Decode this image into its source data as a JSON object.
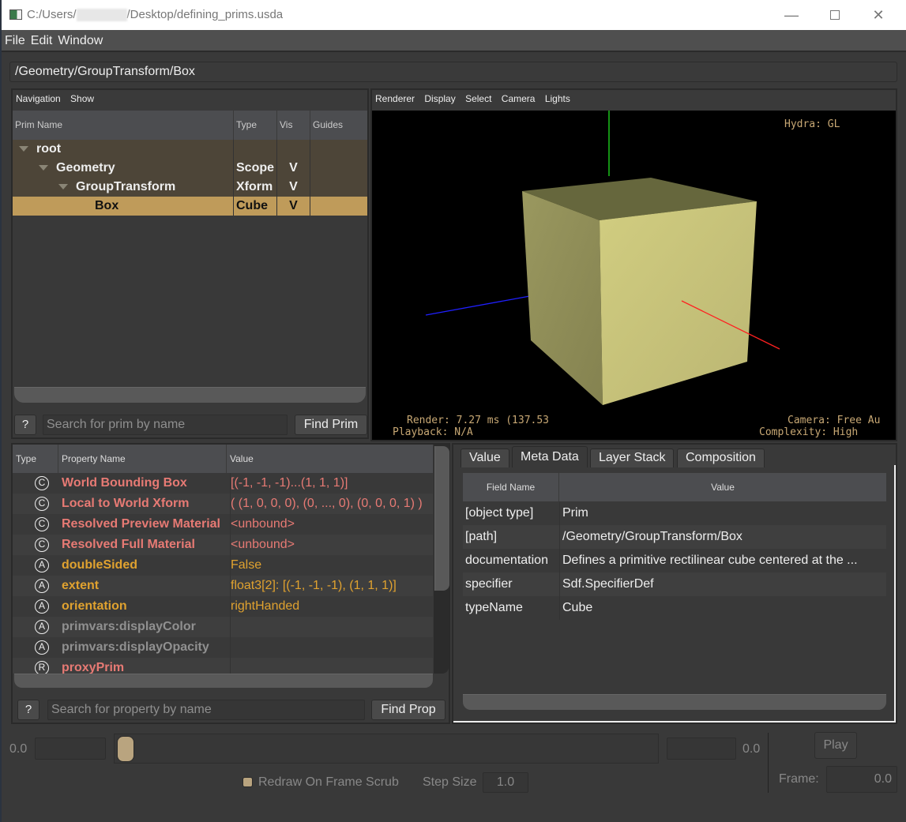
{
  "window": {
    "title_prefix": "C:/Users/",
    "title_suffix": "/Desktop/defining_prims.usda",
    "minimize": "—",
    "maximize": "☐",
    "close": "✕"
  },
  "menubar": {
    "items": [
      "File",
      "Edit",
      "Window"
    ]
  },
  "path_field": {
    "value": "/Geometry/GroupTransform/Box"
  },
  "prim_browser": {
    "menus": [
      "Navigation",
      "Show"
    ],
    "columns": [
      "Prim Name",
      "Type",
      "Vis",
      "Guides"
    ],
    "rows": [
      {
        "name": "root",
        "type": "",
        "vis": "",
        "guides": "",
        "depth": 0,
        "expanded": true,
        "selected": false
      },
      {
        "name": "Geometry",
        "type": "Scope",
        "vis": "V",
        "guides": "",
        "depth": 1,
        "expanded": true,
        "selected": false
      },
      {
        "name": "GroupTransform",
        "type": "Xform",
        "vis": "V",
        "guides": "",
        "depth": 2,
        "expanded": true,
        "selected": false
      },
      {
        "name": "Box",
        "type": "Cube",
        "vis": "V",
        "guides": "",
        "depth": 3,
        "expanded": false,
        "selected": true
      }
    ],
    "help_label": "?",
    "search_placeholder": "Search for prim by name",
    "find_label": "Find Prim"
  },
  "viewport": {
    "menus": [
      "Renderer",
      "Display",
      "Select",
      "Camera",
      "Lights"
    ],
    "renderer_label": "Hydra: GL",
    "hud_render": "Render: 7.27 ms (137.53",
    "hud_playback": "Playback: N/A",
    "hud_camera": "Camera: Free Au",
    "hud_complexity": "Complexity: High",
    "colors": {
      "cube_top": "#66673d",
      "cube_left": "#8f8d57",
      "cube_front": "#c9c57a",
      "axis_x": "#ff2020",
      "axis_y": "#20e020",
      "axis_z": "#2020ff"
    }
  },
  "property_view": {
    "columns": [
      "Type",
      "Property Name",
      "Value"
    ],
    "rows": [
      {
        "type_icon": "C",
        "icon_name": "computed-icon",
        "name": "World Bounding Box",
        "value": "[(-1, -1, -1)...(1, 1, 1)]",
        "color": "red"
      },
      {
        "type_icon": "C",
        "icon_name": "computed-icon",
        "name": "Local to World Xform",
        "value": "( (1, 0, 0, 0), (0, ..., 0), (0, 0, 0, 1) )",
        "color": "red"
      },
      {
        "type_icon": "C",
        "icon_name": "computed-icon",
        "name": "Resolved Preview Material",
        "value": "<unbound>",
        "color": "red"
      },
      {
        "type_icon": "C",
        "icon_name": "computed-icon",
        "name": "Resolved Full Material",
        "value": "<unbound>",
        "color": "red"
      },
      {
        "type_icon": "A",
        "icon_name": "attribute-icon",
        "name": "doubleSided",
        "value": "False",
        "color": "orange"
      },
      {
        "type_icon": "A",
        "icon_name": "attribute-icon",
        "name": "extent",
        "value": "float3[2]: [(-1, -1, -1), (1, 1, 1)]",
        "color": "orange"
      },
      {
        "type_icon": "A",
        "icon_name": "attribute-icon",
        "name": "orientation",
        "value": "rightHanded",
        "color": "orange"
      },
      {
        "type_icon": "A",
        "icon_name": "attribute-icon",
        "name": "primvars:displayColor",
        "value": "",
        "color": "gray"
      },
      {
        "type_icon": "A",
        "icon_name": "attribute-icon",
        "name": "primvars:displayOpacity",
        "value": "",
        "color": "gray"
      },
      {
        "type_icon": "R",
        "icon_name": "relationship-icon",
        "name": "proxyPrim",
        "value": "",
        "color": "red"
      }
    ],
    "help_label": "?",
    "search_placeholder": "Search for property by name",
    "find_label": "Find Prop"
  },
  "inspector": {
    "tabs": [
      {
        "label": "Value",
        "active": false
      },
      {
        "label": "Meta Data",
        "active": true
      },
      {
        "label": "Layer Stack",
        "active": false
      },
      {
        "label": "Composition",
        "active": false
      }
    ],
    "columns": [
      "Field Name",
      "Value"
    ],
    "rows": [
      {
        "field": "[object type]",
        "value": "Prim"
      },
      {
        "field": "[path]",
        "value": "/Geometry/GroupTransform/Box"
      },
      {
        "field": "documentation",
        "value": "Defines a primitive rectilinear cube centered at the ..."
      },
      {
        "field": "specifier",
        "value": "Sdf.SpecifierDef"
      },
      {
        "field": "typeName",
        "value": "Cube"
      }
    ]
  },
  "timeline": {
    "start_label": "0.0",
    "end_label": "0.0",
    "slider_position": 0.0,
    "redraw_label": "Redraw On Frame Scrub",
    "redraw_checked": true,
    "step_label": "Step Size",
    "step_value": "1.0",
    "play_label": "Play",
    "frame_label": "Frame:",
    "frame_value": "0.0"
  },
  "colors": {
    "selection": "#bf9b5a",
    "computed_text": "#e77a74",
    "attribute_text": "#e0a22f",
    "unauthored_text": "#909090"
  }
}
